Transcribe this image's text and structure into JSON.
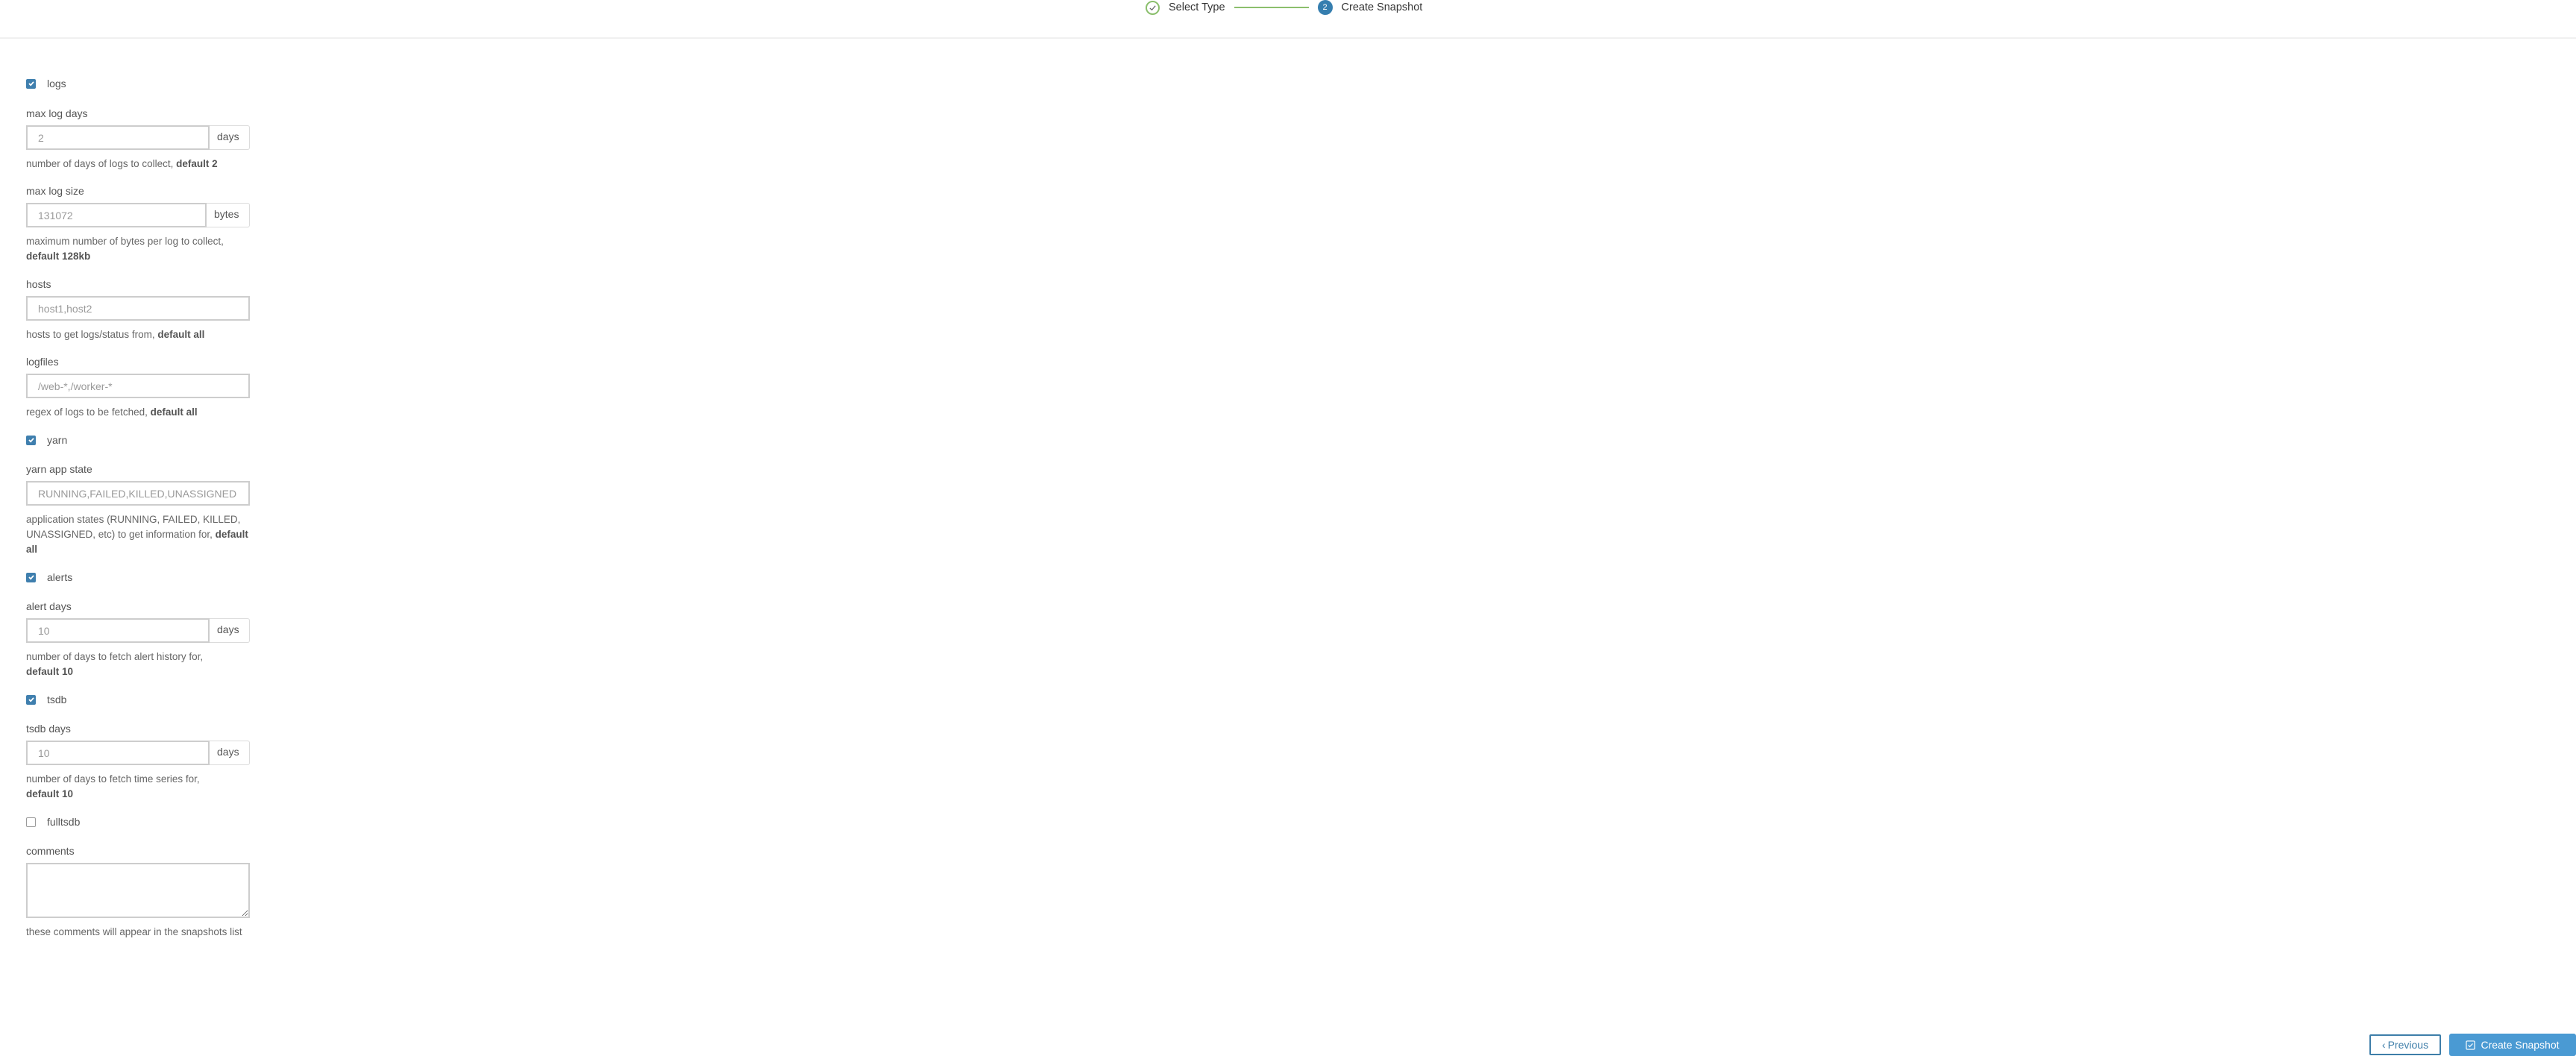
{
  "wizard": {
    "steps": [
      {
        "label": "Select Type",
        "status": "complete",
        "icon": "check-circle-icon"
      },
      {
        "label": "Create Snapshot",
        "status": "current",
        "number": "2"
      }
    ]
  },
  "form": {
    "logs": {
      "checkbox_label": "logs",
      "checked": true,
      "max_log_days": {
        "label": "max log days",
        "placeholder": "2",
        "value": "",
        "addon": "days",
        "help": "number of days of logs to collect, ",
        "help_bold": "default 2"
      },
      "max_log_size": {
        "label": "max log size",
        "placeholder": "131072",
        "value": "",
        "addon": "bytes",
        "help": "maximum number of bytes per log to collect, ",
        "help_bold": "default 128kb"
      },
      "hosts": {
        "label": "hosts",
        "placeholder": "host1,host2",
        "value": "",
        "help": "hosts to get logs/status from, ",
        "help_bold": "default all"
      },
      "logfiles": {
        "label": "logfiles",
        "placeholder": "/web-*,/worker-*",
        "value": "",
        "help": "regex of logs to be fetched, ",
        "help_bold": "default all"
      }
    },
    "yarn": {
      "checkbox_label": "yarn",
      "checked": true,
      "app_state": {
        "label": "yarn app state",
        "placeholder": "RUNNING,FAILED,KILLED,UNASSIGNED",
        "value": "",
        "help": "application states (RUNNING, FAILED, KILLED, UNASSIGNED, etc) to get information for, ",
        "help_bold": "default all"
      }
    },
    "alerts": {
      "checkbox_label": "alerts",
      "checked": true,
      "alert_days": {
        "label": "alert days",
        "placeholder": "10",
        "value": "",
        "addon": "days",
        "help": "number of days to fetch alert history for, ",
        "help_bold": "default 10"
      }
    },
    "tsdb": {
      "checkbox_label": "tsdb",
      "checked": true,
      "tsdb_days": {
        "label": "tsdb days",
        "placeholder": "10",
        "value": "",
        "addon": "days",
        "help": "number of days to fetch time series for, ",
        "help_bold": "default 10"
      }
    },
    "fulltsdb": {
      "checkbox_label": "fulltsdb",
      "checked": false
    },
    "comments": {
      "label": "comments",
      "value": "",
      "help": "these comments will appear in the snapshots list"
    }
  },
  "footer": {
    "previous_label": "Previous",
    "create_label": "Create Snapshot"
  },
  "colors": {
    "accent": "#4a9ad3",
    "complete": "#8bbf6d",
    "current_step": "#357eaf"
  }
}
